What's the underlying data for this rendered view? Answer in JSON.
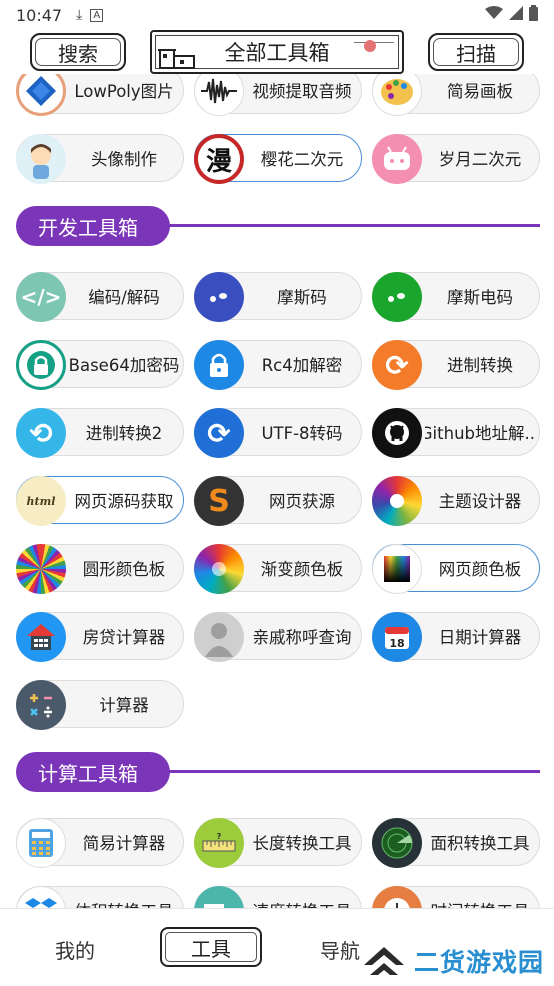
{
  "status": {
    "time": "10:47"
  },
  "topbar": {
    "search_label": "搜索",
    "title": "全部工具箱",
    "scan_label": "扫描"
  },
  "colors": {
    "section_purple": "#7b35b9",
    "selected_border": "#4a8fd6"
  },
  "rows_top": [
    {
      "label": "LowPoly图片",
      "icon": "diamond-icon"
    },
    {
      "label": "视频提取音频",
      "icon": "waveform-icon"
    },
    {
      "label": "简易画板",
      "icon": "palette-icon"
    },
    {
      "label": "头像制作",
      "icon": "avatar-icon"
    },
    {
      "label": "樱花二次元",
      "icon": "man-kanji-icon"
    },
    {
      "label": "岁月二次元",
      "icon": "bilibili-tv-icon"
    }
  ],
  "sections": [
    {
      "title": "开发工具箱",
      "items": [
        {
          "label": "编码/解码",
          "icon": "code-brackets-icon"
        },
        {
          "label": "摩斯码",
          "icon": "morse-dot-icon"
        },
        {
          "label": "摩斯电码",
          "icon": "morse-dot-green-icon"
        },
        {
          "label": "Base64加密码",
          "icon": "lock-green-icon"
        },
        {
          "label": "Rc4加解密",
          "icon": "lock-blue-icon"
        },
        {
          "label": "进制转换",
          "icon": "refresh-orange-icon"
        },
        {
          "label": "进制转换2",
          "icon": "refresh-cyan-icon"
        },
        {
          "label": "UTF-8转码",
          "icon": "sync-blue-icon"
        },
        {
          "label": "Github地址解...",
          "icon": "github-icon"
        },
        {
          "label": "网页源码获取",
          "icon": "html-scroll-icon"
        },
        {
          "label": "网页获源",
          "icon": "s-letter-icon"
        },
        {
          "label": "主题设计器",
          "icon": "color-wheel-icon"
        },
        {
          "label": "圆形颜色板",
          "icon": "radial-palette-icon"
        },
        {
          "label": "渐变颜色板",
          "icon": "gradient-wheel-icon"
        },
        {
          "label": "网页颜色板",
          "icon": "web-palette-icon"
        },
        {
          "label": "房贷计算器",
          "icon": "house-calc-icon"
        },
        {
          "label": "亲戚称呼查询",
          "icon": "person-silhouette-icon"
        },
        {
          "label": "日期计算器",
          "icon": "calendar-icon"
        },
        {
          "label": "计算器",
          "icon": "calculator-icon"
        }
      ]
    },
    {
      "title": "计算工具箱",
      "items": [
        {
          "label": "简易计算器",
          "icon": "calc-keypad-icon"
        },
        {
          "label": "长度转换工具",
          "icon": "ruler-icon"
        },
        {
          "label": "面积转换工具",
          "icon": "radar-icon"
        },
        {
          "label": "体积转换工具",
          "icon": "dropbox-icon"
        },
        {
          "label": "速度转换工具",
          "icon": "truck-icon"
        },
        {
          "label": "时间转换工具",
          "icon": "clock-icon"
        }
      ]
    }
  ],
  "bottomnav": {
    "mine": "我的",
    "tools": "工具",
    "nav": "导航"
  },
  "watermark": {
    "text": "二货游戏园"
  }
}
